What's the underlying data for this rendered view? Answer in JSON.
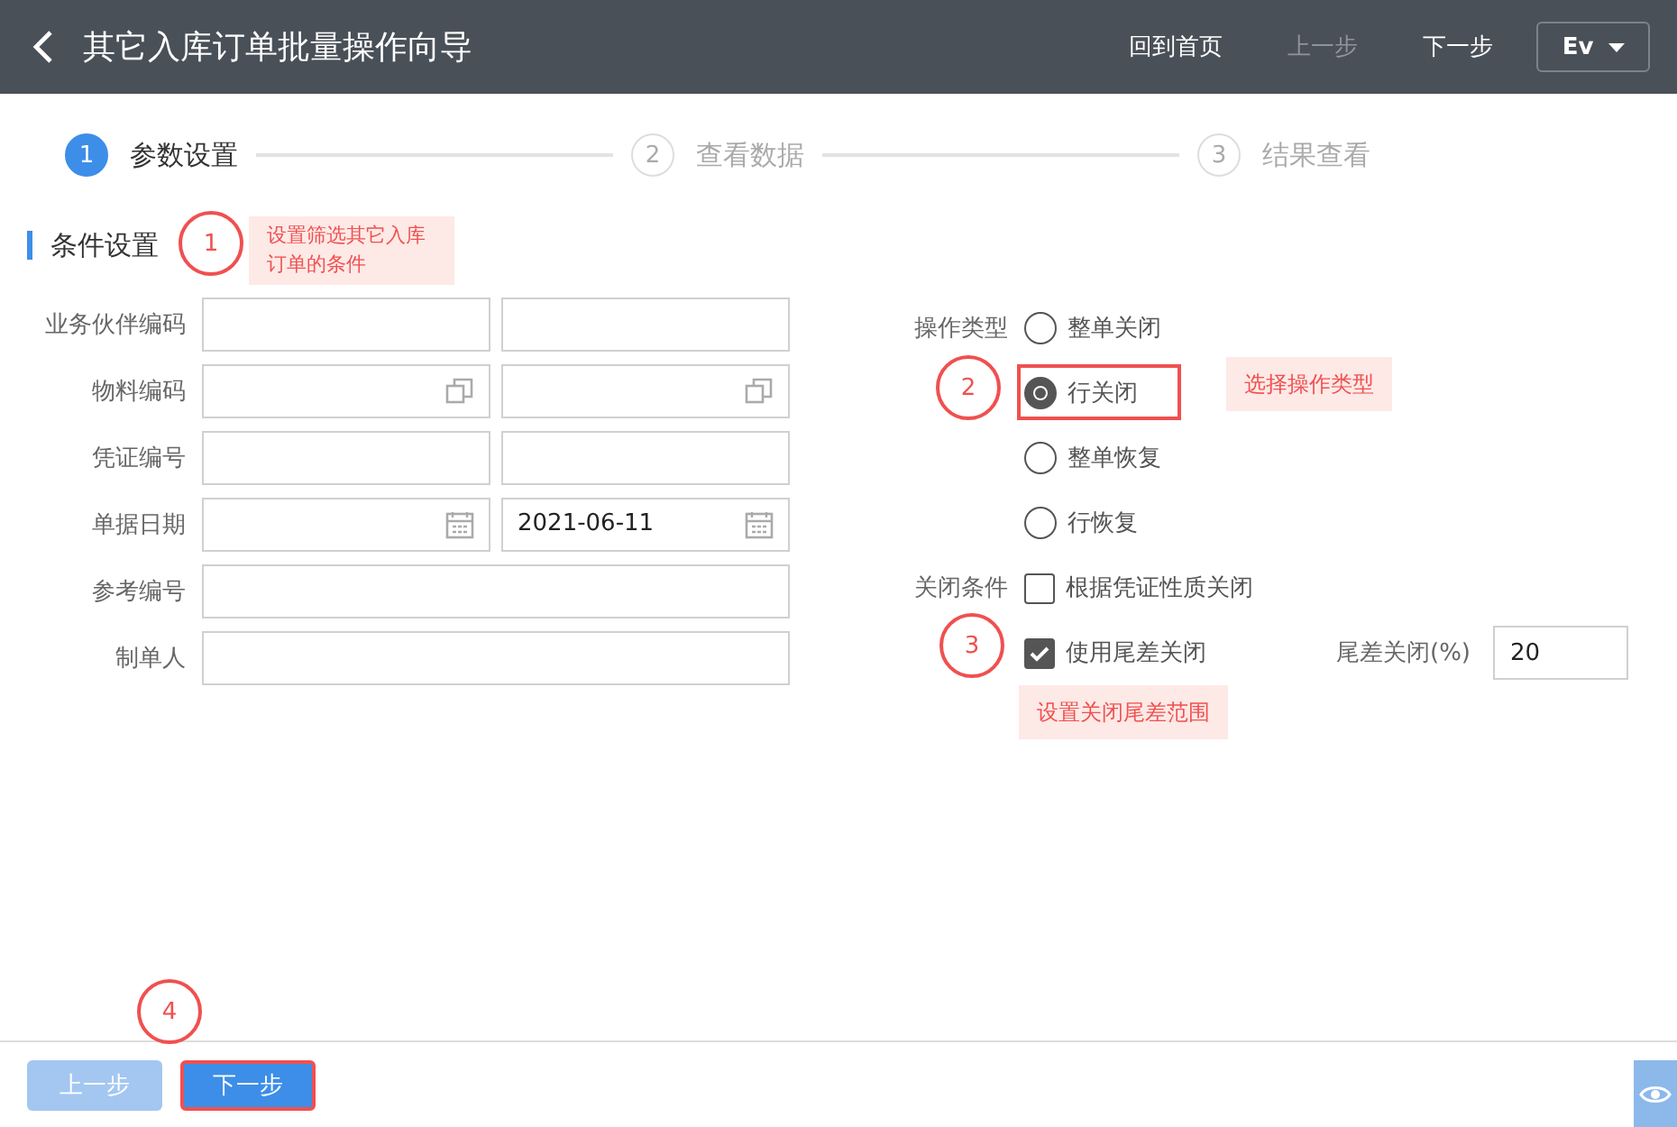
{
  "header": {
    "title": "其它入库订单批量操作向导",
    "nav": [
      {
        "label": "回到首页",
        "disabled": false
      },
      {
        "label": "上一步",
        "disabled": true
      },
      {
        "label": "下一步",
        "disabled": false
      }
    ],
    "language": "Ev"
  },
  "steps": [
    {
      "number": "1",
      "label": "参数设置",
      "active": true
    },
    {
      "number": "2",
      "label": "查看数据",
      "active": false
    },
    {
      "number": "3",
      "label": "结果查看",
      "active": false
    }
  ],
  "section": {
    "title": "条件设置",
    "marker": {
      "number": "1",
      "note": "设置筛选其它入库订单的条件"
    }
  },
  "fields": [
    {
      "label": "业务伙伴编码",
      "kind": "pair",
      "inputs": [
        {
          "kind": "text"
        },
        {
          "kind": "text"
        }
      ]
    },
    {
      "label": "物料编码",
      "kind": "pair",
      "inputs": [
        {
          "kind": "lookup"
        },
        {
          "kind": "lookup"
        }
      ]
    },
    {
      "label": "凭证编号",
      "kind": "pair",
      "inputs": [
        {
          "kind": "text"
        },
        {
          "kind": "text"
        }
      ]
    },
    {
      "label": "单据日期",
      "kind": "pair",
      "inputs": [
        {
          "kind": "date"
        },
        {
          "kind": "date",
          "value": "2021-06-11"
        }
      ]
    },
    {
      "label": "参考编号",
      "kind": "wide",
      "inputs": [
        {
          "kind": "text"
        }
      ]
    },
    {
      "label": "制单人",
      "kind": "wide",
      "inputs": [
        {
          "kind": "text"
        }
      ]
    }
  ],
  "operation_type": {
    "label": "操作类型",
    "marker": {
      "number": "2",
      "note": "选择操作类型"
    },
    "options": [
      {
        "label": "整单关闭",
        "selected": false
      },
      {
        "label": "行关闭",
        "selected": true
      },
      {
        "label": "整单恢复",
        "selected": false
      },
      {
        "label": "行恢复",
        "selected": false
      }
    ]
  },
  "close_condition": {
    "label": "关闭条件",
    "marker": {
      "number": "3",
      "note": "设置关闭尾差范围"
    },
    "options": [
      {
        "label": "根据凭证性质关闭",
        "checked": false
      },
      {
        "label": "使用尾差关闭",
        "checked": true
      }
    ],
    "tolerance": {
      "label": "尾差关闭(%)",
      "value": "20"
    }
  },
  "footer": {
    "marker": {
      "number": "4"
    },
    "buttons": [
      {
        "label": "上一步",
        "disabled": true,
        "highlighted": false
      },
      {
        "label": "下一步",
        "disabled": false,
        "highlighted": true
      }
    ]
  }
}
